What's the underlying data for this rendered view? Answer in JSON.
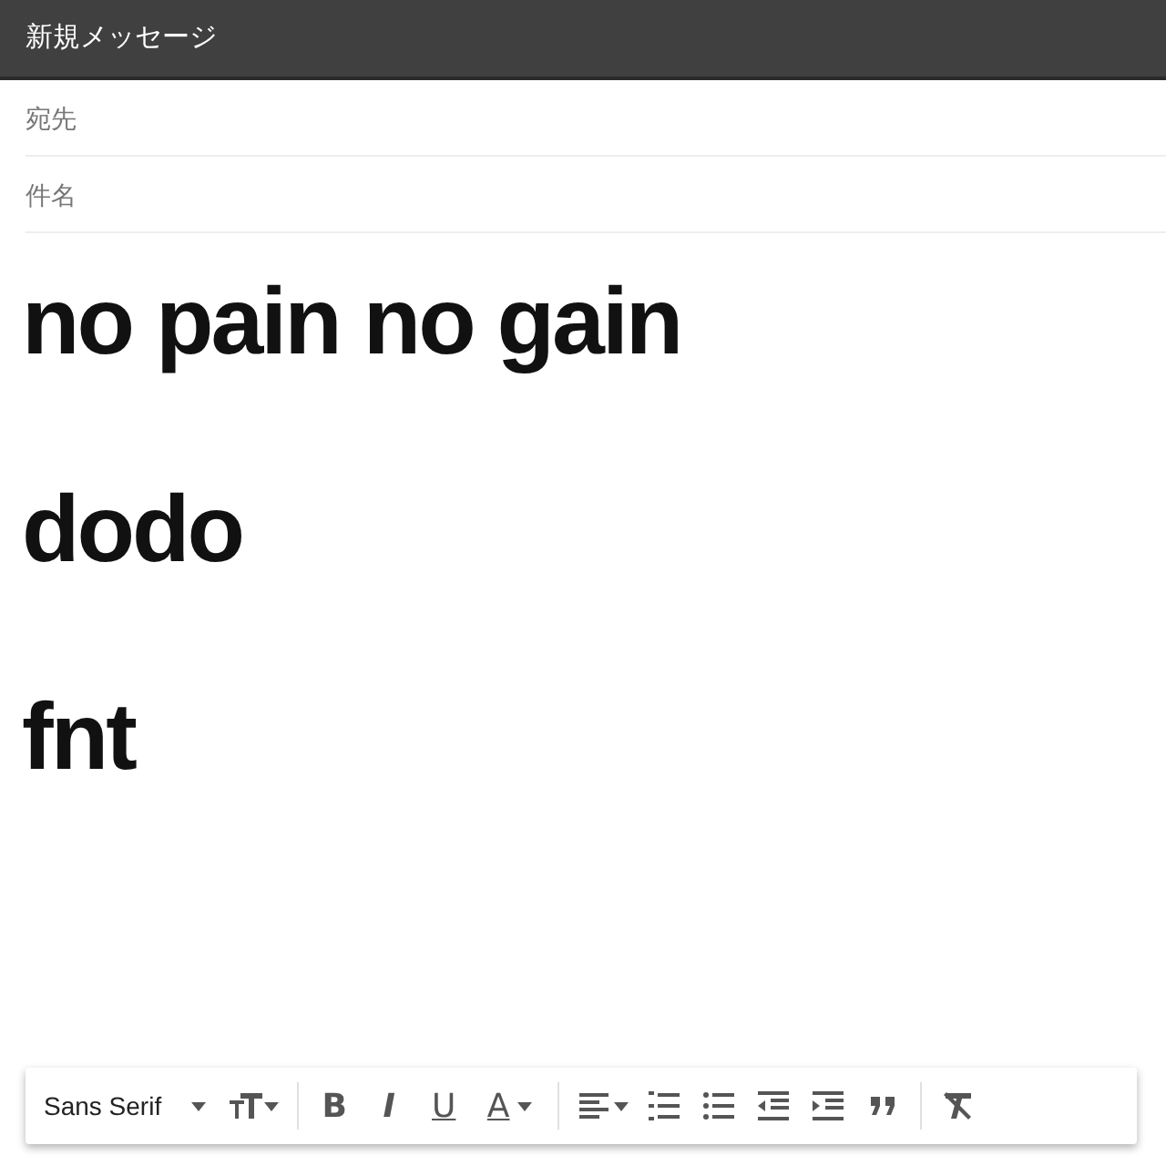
{
  "window": {
    "title": "新規メッセージ"
  },
  "fields": [
    {
      "placeholder": "宛先"
    },
    {
      "placeholder": "件名"
    }
  ],
  "body": [
    "no pain no gain",
    "dodo",
    "fnt"
  ],
  "toolbar": {
    "font": "Sans Serif",
    "items": [
      {
        "kind": "size"
      },
      {
        "kind": "sep"
      },
      {
        "kind": "bold",
        "text": "B"
      },
      {
        "kind": "italic",
        "text": "I"
      },
      {
        "kind": "underline",
        "text": "U"
      },
      {
        "kind": "color",
        "text": "A"
      },
      {
        "kind": "sep"
      },
      {
        "kind": "align"
      },
      {
        "kind": "numbered"
      },
      {
        "kind": "bulleted"
      },
      {
        "kind": "outdent"
      },
      {
        "kind": "indent"
      },
      {
        "kind": "quote"
      },
      {
        "kind": "sep"
      },
      {
        "kind": "clear"
      }
    ]
  }
}
